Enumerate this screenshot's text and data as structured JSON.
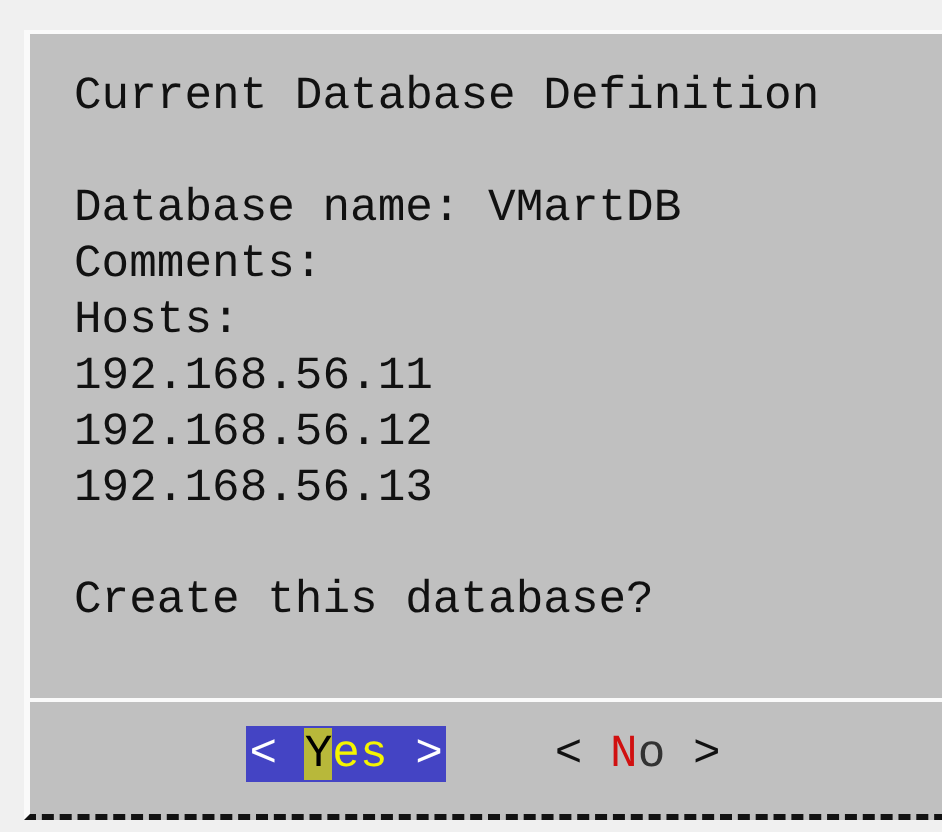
{
  "dialog": {
    "title": "Current Database Definition",
    "lines": [
      "Database name: VMartDB",
      "Comments:",
      "Hosts:",
      "192.168.56.11",
      "192.168.56.12",
      "192.168.56.13"
    ],
    "question": "Create this database?",
    "buttons": [
      {
        "open": "<",
        "label": "Yes",
        "close": ">",
        "selected": true
      },
      {
        "open": "<",
        "label": "No",
        "close": ">",
        "selected": false
      }
    ]
  }
}
